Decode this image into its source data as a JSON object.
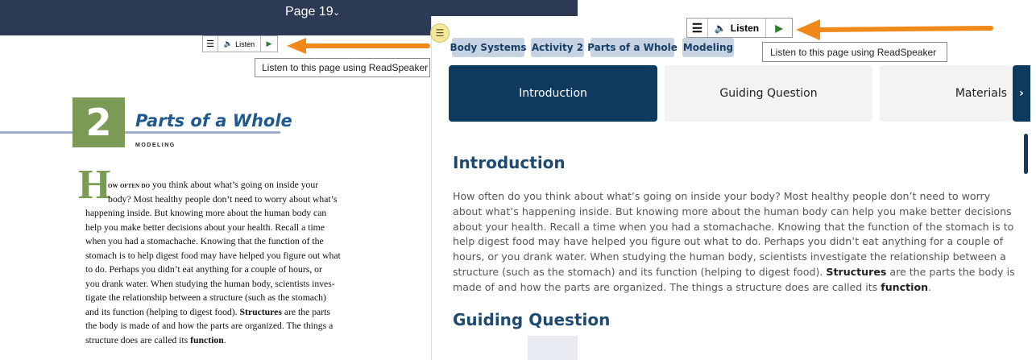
{
  "page_header": {
    "title": "Page 19",
    "chevron": "⌄"
  },
  "readspeaker": {
    "listen_label": "Listen",
    "tooltip": "Listen to this page using ReadSpeaker"
  },
  "book": {
    "chapter_number": "2",
    "chapter_title": "Parts of a Whole",
    "chapter_subtitle": "MODELING",
    "dropcap": "H",
    "lead_smallcaps": "ow often do",
    "lines": [
      " you think about what’s going on inside your",
      "body? Most healthy people don’t need to worry about what’s",
      "happening inside. But knowing more about the human body can",
      "help you make better decisions about your health. Recall a time",
      "when you had a stomachache. Knowing that the function of the",
      "stomach is to help digest food may have helped you figure out what",
      "to do. Perhaps you didn’t eat anything for a couple of hours, or",
      "you drank water. When studying the human body, scientists inves-",
      "tigate the relationship between a structure (such as the stomach)",
      "and its function (helping to digest food). ",
      "Structures",
      " are the parts",
      "the body is made of and how the parts are organized. The things a",
      "structure does are called its ",
      "function",
      "."
    ]
  },
  "breadcrumbs": [
    "Body Systems",
    "Activity 2",
    "Parts of a Whole",
    "Modeling"
  ],
  "tabs": [
    {
      "label": "Introduction",
      "active": true
    },
    {
      "label": "Guiding Question",
      "active": false
    },
    {
      "label": "Materials",
      "active": false
    }
  ],
  "tab_next": "›",
  "content": {
    "heading": "Introduction",
    "lines": [
      "How often do you think about what’s going on inside your body? Most healthy people don’t need to worry",
      "about what’s happening inside. But knowing more about the human body can help you make better decisions",
      "about your health. Recall a time when you had a stomachache. Knowing that the function of the stomach is to",
      "help digest food may have helped you figure out what to do. Perhaps you didn’t eat anything for a couple of",
      "hours, or you drank water. When studying the human body, scientists investigate the relationship between a",
      "structure (such as the stomach) and its function (helping to digest food). ",
      "Structures",
      " are the parts the body is",
      "made of and how the parts are organized. The things a structure does are called its ",
      "function",
      "."
    ],
    "next_heading": "Guiding Question"
  },
  "colors": {
    "accent_navy": "#0e3a5f",
    "arrow_orange": "#f0891a",
    "chapter_green": "#7a9a55"
  }
}
